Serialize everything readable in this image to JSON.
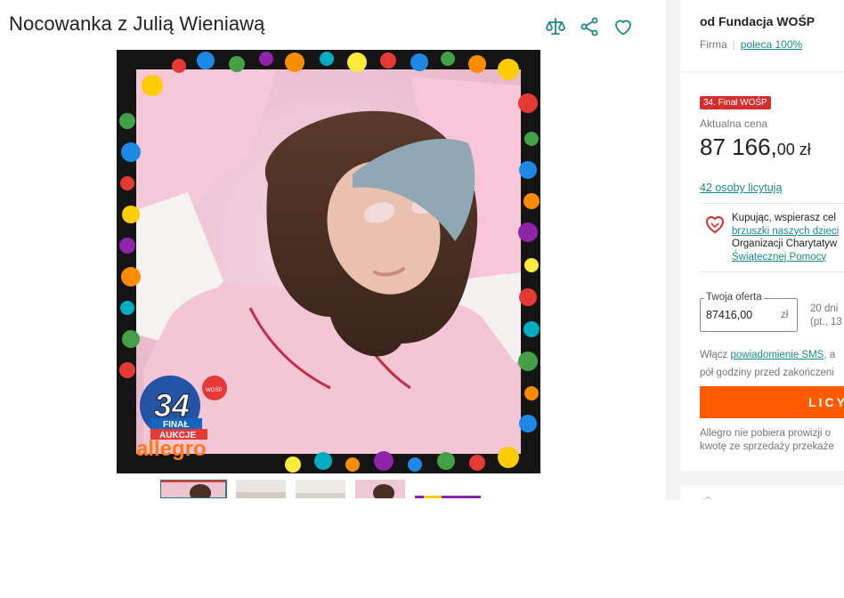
{
  "product": {
    "title": "Nocowanka z Julią Wieniawą",
    "actions": [
      {
        "icon": "compare-icon"
      },
      {
        "icon": "share-icon"
      },
      {
        "icon": "heart-icon"
      }
    ],
    "image_badge": {
      "number": "34",
      "line1": "FINAŁ",
      "line2": "AUKCJE",
      "brand": "allegro",
      "heart_text": "WOŚP"
    },
    "thumbnails": 5
  },
  "seller": {
    "name": "od Fundacja WOŚP",
    "type": "Firma",
    "recommend": "poleca 100%"
  },
  "offer": {
    "badge": "34. Finał WOŚP",
    "price_label": "Aktualna cena",
    "price_int": "87 166,",
    "price_dec": "00 zł",
    "bidders": "42 osoby licytują",
    "charity_line1": "Kupując, wspierasz cel",
    "charity_link1": "brzuszki naszych dzieci",
    "charity_line3": "Organizacji Charytatyw",
    "charity_link2": "Świątecznej Pomocy",
    "your_offer_label": "Twoja oferta",
    "your_offer_value": "87416,00",
    "currency": "zł",
    "time_line1": "20 dni",
    "time_line2": "(pt., 13",
    "sms_prefix": "Włącz ",
    "sms_link": "powiadomienie SMS",
    "sms_suffix": ", a",
    "sms_line2": "pół godziny przed zakończeni",
    "bid_button": "LICY",
    "note_line1": "Allegro nie pobiera prowizji o",
    "note_line2": "kwotę ze sprzedaży przekaże"
  },
  "colors": {
    "accent": "#1a8a8e",
    "bid_button": "#ff5a00",
    "badge": "#d32f2f"
  }
}
